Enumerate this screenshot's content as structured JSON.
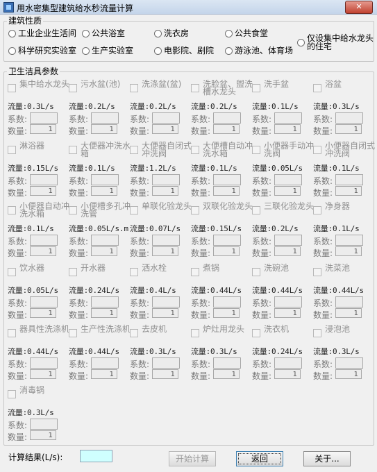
{
  "window": {
    "title": "用水密集型建筑给水秒流量计算"
  },
  "building": {
    "title": "建筑性质",
    "options": [
      {
        "label": "工业企业生活间"
      },
      {
        "label": "公共浴室"
      },
      {
        "label": "洗衣房"
      },
      {
        "label": "公共食堂"
      },
      {
        "label": "仅设集中给水龙头的住宅"
      },
      {
        "label": "科学研究实验室"
      },
      {
        "label": "生产实验室"
      },
      {
        "label": "电影院、剧院"
      },
      {
        "label": "游泳池、体育场"
      }
    ]
  },
  "fixtures_group": {
    "title": "卫生洁具参数",
    "coef_label": "系数:",
    "qty_label": "数量:",
    "items": [
      {
        "name": "集中给水龙头",
        "flow": "流量:0.3L/s",
        "qty": "1"
      },
      {
        "name": "污水盆(池)",
        "flow": "流量:0.2L/s",
        "qty": "1"
      },
      {
        "name": "洗涤盆(盆)",
        "flow": "流量:0.2L/s",
        "qty": "1"
      },
      {
        "name": "洗脸盆、盥洗槽水龙头",
        "flow": "流量:0.2L/s",
        "qty": "1"
      },
      {
        "name": "洗手盆",
        "flow": "流量:0.1L/s",
        "qty": "1"
      },
      {
        "name": "浴盆",
        "flow": "流量:0.3L/s",
        "qty": "1"
      },
      {
        "name": "淋浴器",
        "flow": "流量:0.15L/s",
        "qty": "1"
      },
      {
        "name": "大便器冲洗水箱",
        "flow": "流量:0.1L/s",
        "qty": "1"
      },
      {
        "name": "大便器自闭式冲洗阀",
        "flow": "流量:1.2L/s",
        "qty": "1"
      },
      {
        "name": "大便槽自动冲洗水箱",
        "flow": "流量:0.1L/s",
        "qty": "1"
      },
      {
        "name": "小便器手动冲洗阀",
        "flow": "流量:0.05L/s",
        "qty": "1"
      },
      {
        "name": "小便器自闭式冲洗阀",
        "flow": "流量:0.1L/s",
        "qty": "1"
      },
      {
        "name": "小便器自动冲洗水箱",
        "flow": "流量:0.1L/s",
        "qty": "1"
      },
      {
        "name": "小便槽多孔冲洗管",
        "flow": "流量:0.05L/s.m",
        "qty": "1"
      },
      {
        "name": "单联化验龙头",
        "flow": "流量:0.07L/s",
        "qty": "1"
      },
      {
        "name": "双联化验龙头",
        "flow": "流量:0.15L/s",
        "qty": "1"
      },
      {
        "name": "三联化验龙头",
        "flow": "流量:0.2L/s",
        "qty": "1"
      },
      {
        "name": "净身器",
        "flow": "流量:0.1L/s",
        "qty": "1"
      },
      {
        "name": "饮水器",
        "flow": "流量:0.05L/s",
        "qty": "1"
      },
      {
        "name": "开水器",
        "flow": "流量:0.24L/s",
        "qty": "1"
      },
      {
        "name": "洒水栓",
        "flow": "流量:0.4L/s",
        "qty": "1"
      },
      {
        "name": "煮锅",
        "flow": "流量:0.44L/s",
        "qty": "1"
      },
      {
        "name": "洗碗池",
        "flow": "流量:0.44L/s",
        "qty": "1"
      },
      {
        "name": "洗菜池",
        "flow": "流量:0.44L/s",
        "qty": "1"
      },
      {
        "name": "器具性洗涤机",
        "flow": "流量:0.44L/s",
        "qty": "1"
      },
      {
        "name": "生产性洗涤机",
        "flow": "流量:0.44L/s",
        "qty": "1"
      },
      {
        "name": "去皮机",
        "flow": "流量:0.3L/s",
        "qty": "1"
      },
      {
        "name": "炉灶用龙头",
        "flow": "流量:0.3L/s",
        "qty": "1"
      },
      {
        "name": "洗衣机",
        "flow": "流量:0.24L/s",
        "qty": "1"
      },
      {
        "name": "浸泡池",
        "flow": "流量:0.3L/s",
        "qty": "1"
      },
      {
        "name": "消毒锅",
        "flow": "流量:0.3L/s",
        "qty": "1"
      }
    ]
  },
  "footer": {
    "result_label": "计算结果(L/s):",
    "start_button": "开始计算",
    "back_button": "返回",
    "about_button": "关于..."
  },
  "colors": {
    "result_field": "#cfffff",
    "disabled_text": "#8f8f8f"
  }
}
